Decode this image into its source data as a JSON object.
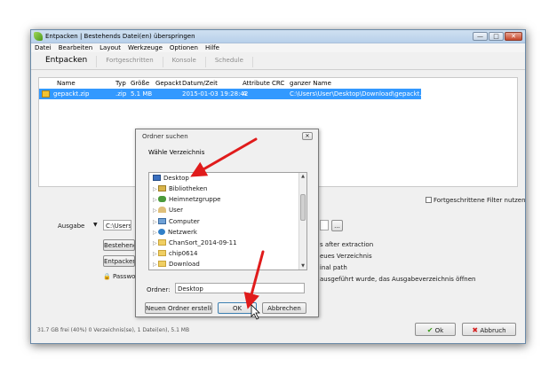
{
  "window": {
    "title": "Entpacken | Bestehends Datei(en) überspringen",
    "controls": {
      "minimize": "—",
      "maximize": "□",
      "close": "✕"
    }
  },
  "menu": [
    "Datei",
    "Bearbeiten",
    "Layout",
    "Werkzeuge",
    "Optionen",
    "Hilfe"
  ],
  "tabs": [
    "Entpacken",
    "Fortgeschritten",
    "Konsole",
    "Schedule"
  ],
  "columns": [
    "Name",
    "Typ",
    "Größe",
    "Gepackt",
    "Datum/Zeit",
    "Attribute",
    "CRC",
    "ganzer Name"
  ],
  "file": {
    "name": "gepackt.zip",
    "type": ".zip",
    "size": "5.1 MB",
    "packed": "",
    "date": "2015-01-03 19:28:42",
    "attr": "A",
    "crc": "",
    "fullname": "C:\\Users\\User\\Desktop\\Download\\gepackt.zip"
  },
  "filter_label": "Fortgeschrittene Filter nutzen",
  "output": {
    "label": "Ausgabe",
    "path": "C:\\Users\\U",
    "browse": "...",
    "btn1": "Bestehend",
    "btn2": "Entpacken",
    "password": "Passwor",
    "opt1": "s after extraction",
    "opt2": "eues Verzeichnis",
    "opt3": "inal path",
    "opt4": "ausgeführt wurde, das Ausgabeverzeichnis öffnen"
  },
  "status": "31.7 GB frei (40%)   0 Verzeichnis(se), 1 Datei(en), 5.1 MB",
  "ok_button": "Ok",
  "cancel_button": "Abbruch",
  "dialog": {
    "title": "Ordner suchen",
    "close": "✕",
    "subtitle": "Wähle Verzeichnis",
    "tree": [
      "Desktop",
      "Bibliotheken",
      "Heimnetzgruppe",
      "User",
      "Computer",
      "Netzwerk",
      "ChanSort_2014-09-11",
      "chip0614",
      "Download"
    ],
    "folder_label": "Ordner:",
    "folder_value": "Desktop",
    "new_folder": "Neuen Ordner erstellen",
    "ok": "OK",
    "cancel": "Abbrechen"
  },
  "colors": {
    "selection": "#3399ff",
    "annotation_arrow": "#e01b1b"
  }
}
